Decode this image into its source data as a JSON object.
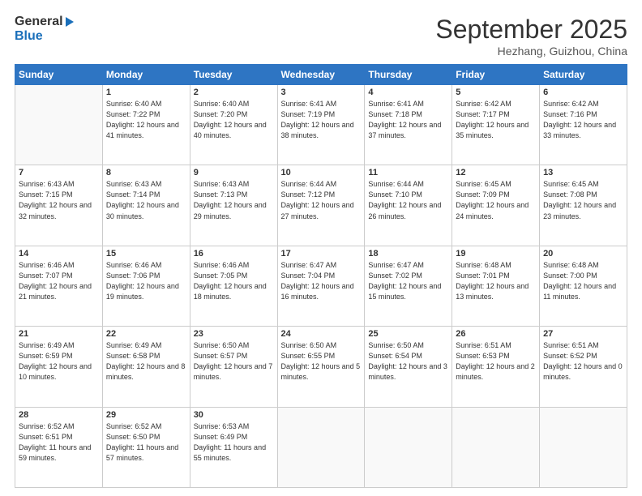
{
  "header": {
    "logo_general": "General",
    "logo_blue": "Blue",
    "month_title": "September 2025",
    "location": "Hezhang, Guizhou, China"
  },
  "days_of_week": [
    "Sunday",
    "Monday",
    "Tuesday",
    "Wednesday",
    "Thursday",
    "Friday",
    "Saturday"
  ],
  "weeks": [
    [
      {
        "num": "",
        "sunrise": "",
        "sunset": "",
        "daylight": ""
      },
      {
        "num": "1",
        "sunrise": "Sunrise: 6:40 AM",
        "sunset": "Sunset: 7:22 PM",
        "daylight": "Daylight: 12 hours and 41 minutes."
      },
      {
        "num": "2",
        "sunrise": "Sunrise: 6:40 AM",
        "sunset": "Sunset: 7:20 PM",
        "daylight": "Daylight: 12 hours and 40 minutes."
      },
      {
        "num": "3",
        "sunrise": "Sunrise: 6:41 AM",
        "sunset": "Sunset: 7:19 PM",
        "daylight": "Daylight: 12 hours and 38 minutes."
      },
      {
        "num": "4",
        "sunrise": "Sunrise: 6:41 AM",
        "sunset": "Sunset: 7:18 PM",
        "daylight": "Daylight: 12 hours and 37 minutes."
      },
      {
        "num": "5",
        "sunrise": "Sunrise: 6:42 AM",
        "sunset": "Sunset: 7:17 PM",
        "daylight": "Daylight: 12 hours and 35 minutes."
      },
      {
        "num": "6",
        "sunrise": "Sunrise: 6:42 AM",
        "sunset": "Sunset: 7:16 PM",
        "daylight": "Daylight: 12 hours and 33 minutes."
      }
    ],
    [
      {
        "num": "7",
        "sunrise": "Sunrise: 6:43 AM",
        "sunset": "Sunset: 7:15 PM",
        "daylight": "Daylight: 12 hours and 32 minutes."
      },
      {
        "num": "8",
        "sunrise": "Sunrise: 6:43 AM",
        "sunset": "Sunset: 7:14 PM",
        "daylight": "Daylight: 12 hours and 30 minutes."
      },
      {
        "num": "9",
        "sunrise": "Sunrise: 6:43 AM",
        "sunset": "Sunset: 7:13 PM",
        "daylight": "Daylight: 12 hours and 29 minutes."
      },
      {
        "num": "10",
        "sunrise": "Sunrise: 6:44 AM",
        "sunset": "Sunset: 7:12 PM",
        "daylight": "Daylight: 12 hours and 27 minutes."
      },
      {
        "num": "11",
        "sunrise": "Sunrise: 6:44 AM",
        "sunset": "Sunset: 7:10 PM",
        "daylight": "Daylight: 12 hours and 26 minutes."
      },
      {
        "num": "12",
        "sunrise": "Sunrise: 6:45 AM",
        "sunset": "Sunset: 7:09 PM",
        "daylight": "Daylight: 12 hours and 24 minutes."
      },
      {
        "num": "13",
        "sunrise": "Sunrise: 6:45 AM",
        "sunset": "Sunset: 7:08 PM",
        "daylight": "Daylight: 12 hours and 23 minutes."
      }
    ],
    [
      {
        "num": "14",
        "sunrise": "Sunrise: 6:46 AM",
        "sunset": "Sunset: 7:07 PM",
        "daylight": "Daylight: 12 hours and 21 minutes."
      },
      {
        "num": "15",
        "sunrise": "Sunrise: 6:46 AM",
        "sunset": "Sunset: 7:06 PM",
        "daylight": "Daylight: 12 hours and 19 minutes."
      },
      {
        "num": "16",
        "sunrise": "Sunrise: 6:46 AM",
        "sunset": "Sunset: 7:05 PM",
        "daylight": "Daylight: 12 hours and 18 minutes."
      },
      {
        "num": "17",
        "sunrise": "Sunrise: 6:47 AM",
        "sunset": "Sunset: 7:04 PM",
        "daylight": "Daylight: 12 hours and 16 minutes."
      },
      {
        "num": "18",
        "sunrise": "Sunrise: 6:47 AM",
        "sunset": "Sunset: 7:02 PM",
        "daylight": "Daylight: 12 hours and 15 minutes."
      },
      {
        "num": "19",
        "sunrise": "Sunrise: 6:48 AM",
        "sunset": "Sunset: 7:01 PM",
        "daylight": "Daylight: 12 hours and 13 minutes."
      },
      {
        "num": "20",
        "sunrise": "Sunrise: 6:48 AM",
        "sunset": "Sunset: 7:00 PM",
        "daylight": "Daylight: 12 hours and 11 minutes."
      }
    ],
    [
      {
        "num": "21",
        "sunrise": "Sunrise: 6:49 AM",
        "sunset": "Sunset: 6:59 PM",
        "daylight": "Daylight: 12 hours and 10 minutes."
      },
      {
        "num": "22",
        "sunrise": "Sunrise: 6:49 AM",
        "sunset": "Sunset: 6:58 PM",
        "daylight": "Daylight: 12 hours and 8 minutes."
      },
      {
        "num": "23",
        "sunrise": "Sunrise: 6:50 AM",
        "sunset": "Sunset: 6:57 PM",
        "daylight": "Daylight: 12 hours and 7 minutes."
      },
      {
        "num": "24",
        "sunrise": "Sunrise: 6:50 AM",
        "sunset": "Sunset: 6:55 PM",
        "daylight": "Daylight: 12 hours and 5 minutes."
      },
      {
        "num": "25",
        "sunrise": "Sunrise: 6:50 AM",
        "sunset": "Sunset: 6:54 PM",
        "daylight": "Daylight: 12 hours and 3 minutes."
      },
      {
        "num": "26",
        "sunrise": "Sunrise: 6:51 AM",
        "sunset": "Sunset: 6:53 PM",
        "daylight": "Daylight: 12 hours and 2 minutes."
      },
      {
        "num": "27",
        "sunrise": "Sunrise: 6:51 AM",
        "sunset": "Sunset: 6:52 PM",
        "daylight": "Daylight: 12 hours and 0 minutes."
      }
    ],
    [
      {
        "num": "28",
        "sunrise": "Sunrise: 6:52 AM",
        "sunset": "Sunset: 6:51 PM",
        "daylight": "Daylight: 11 hours and 59 minutes."
      },
      {
        "num": "29",
        "sunrise": "Sunrise: 6:52 AM",
        "sunset": "Sunset: 6:50 PM",
        "daylight": "Daylight: 11 hours and 57 minutes."
      },
      {
        "num": "30",
        "sunrise": "Sunrise: 6:53 AM",
        "sunset": "Sunset: 6:49 PM",
        "daylight": "Daylight: 11 hours and 55 minutes."
      },
      {
        "num": "",
        "sunrise": "",
        "sunset": "",
        "daylight": ""
      },
      {
        "num": "",
        "sunrise": "",
        "sunset": "",
        "daylight": ""
      },
      {
        "num": "",
        "sunrise": "",
        "sunset": "",
        "daylight": ""
      },
      {
        "num": "",
        "sunrise": "",
        "sunset": "",
        "daylight": ""
      }
    ]
  ]
}
